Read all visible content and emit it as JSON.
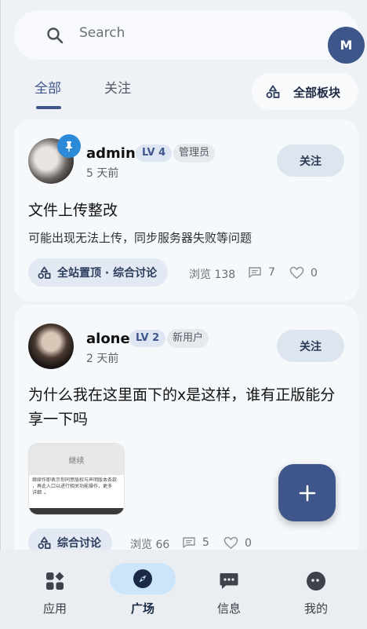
{
  "search": {
    "placeholder": "Search",
    "avatar_initial": "M"
  },
  "tabs": [
    {
      "label": "全部"
    },
    {
      "label": "关注"
    }
  ],
  "boards_button": {
    "label": "全部板块"
  },
  "posts": [
    {
      "username": "admin",
      "level": "LV 4",
      "role": "管理员",
      "time": "5 天前",
      "follow_label": "关注",
      "title": "文件上传整改",
      "description": "可能出现无法上传，同步服务器失败等问题",
      "tag": "全站置顶 · 综合讨论",
      "views_label": "浏览 138",
      "comments": "7",
      "likes": "0",
      "pinned": true
    },
    {
      "username": "alone",
      "level": "LV 2",
      "role": "新用户",
      "time": "2 天前",
      "follow_label": "关注",
      "title": "为什么我在这里面下的x是这样，谁有正版能分享一下吗",
      "tag": "综合讨论",
      "views_label": "浏览 66",
      "comments": "5",
      "likes": "0",
      "thumbnail": {
        "header": "继续",
        "lines": [
          "继续作即表示你同意版权与声明版本条款",
          "，再此入口以进行相关功能操作，更多",
          "详细 ⌄"
        ]
      }
    }
  ],
  "bottom_nav": [
    {
      "label": "应用",
      "icon": "apps-icon"
    },
    {
      "label": "广场",
      "icon": "compass-icon",
      "active": true
    },
    {
      "label": "信息",
      "icon": "chat-icon"
    },
    {
      "label": "我的",
      "icon": "profile-icon"
    }
  ],
  "colors": {
    "primary": "#3f568b",
    "active_nav_bg": "#cde5fb",
    "pin": "#2d8ad8"
  }
}
